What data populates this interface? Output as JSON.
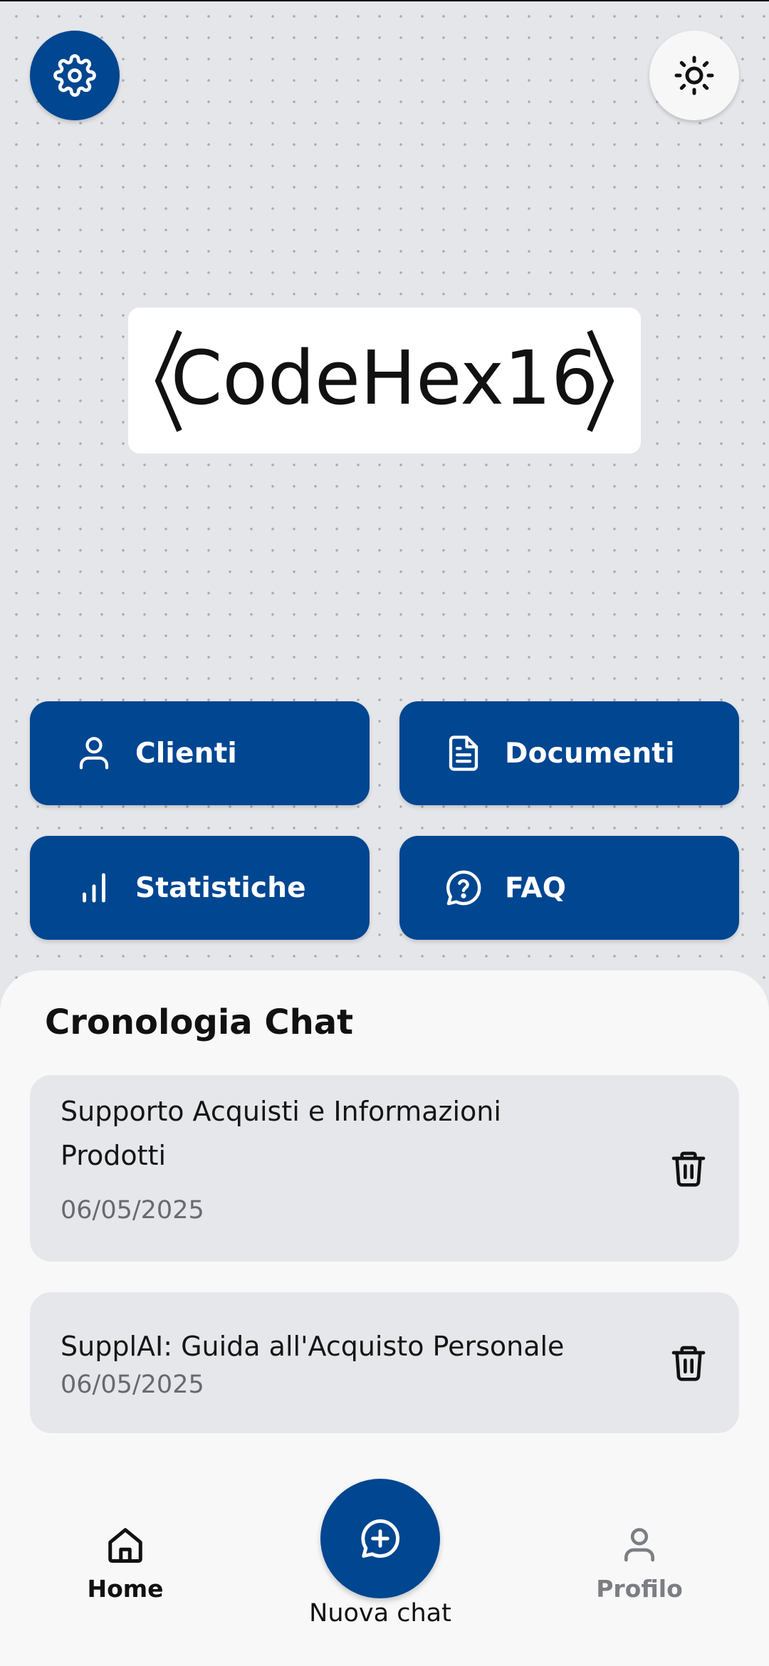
{
  "header": {
    "settings_icon": "gear-icon",
    "theme_icon": "sun-icon"
  },
  "logo": {
    "text": "CodeHex16"
  },
  "actions": [
    {
      "label": "Clienti",
      "icon": "user-icon"
    },
    {
      "label": "Documenti",
      "icon": "document-icon"
    },
    {
      "label": "Statistiche",
      "icon": "bar-chart-icon"
    },
    {
      "label": "FAQ",
      "icon": "question-bubble-icon"
    }
  ],
  "history": {
    "title": "Cronologia Chat",
    "chats": [
      {
        "title": "Supporto Acquisti e Informazioni Prodotti",
        "date": "06/05/2025"
      },
      {
        "title": "SupplAI: Guida all'Acquisto Personale",
        "date": "06/05/2025"
      }
    ]
  },
  "nav": {
    "home_label": "Home",
    "new_chat_label": "Nuova chat",
    "profile_label": "Profilo"
  },
  "colors": {
    "primary": "#004690",
    "background": "#e5e6ea",
    "card": "#e6e7ea",
    "inactive": "#7c7e83"
  }
}
